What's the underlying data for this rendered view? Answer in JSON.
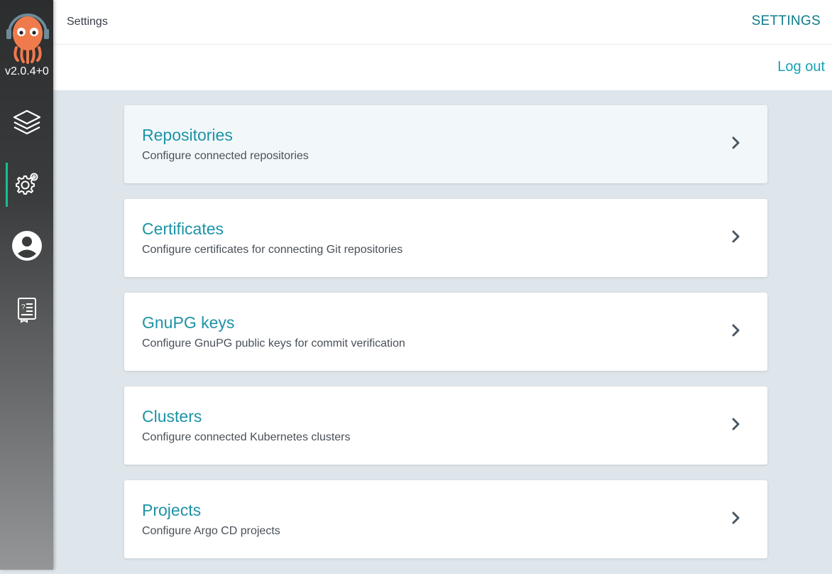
{
  "sidebar": {
    "version": "v2.0.4+0",
    "logo": "argo-octopus-logo",
    "nav": [
      {
        "id": "applications",
        "icon": "layers-icon",
        "active": false
      },
      {
        "id": "settings",
        "icon": "gears-icon",
        "active": true
      },
      {
        "id": "user-info",
        "icon": "user-icon",
        "active": false
      },
      {
        "id": "docs",
        "icon": "help-book-icon",
        "active": false
      }
    ]
  },
  "header": {
    "breadcrumb": "Settings",
    "title": "SETTINGS"
  },
  "toolbar": {
    "logout_label": "Log out"
  },
  "cards": [
    {
      "title": "Repositories",
      "description": "Configure connected repositories",
      "icon": "chevron-right-icon"
    },
    {
      "title": "Certificates",
      "description": "Configure certificates for connecting Git repositories",
      "icon": "chevron-right-icon"
    },
    {
      "title": "GnuPG keys",
      "description": "Configure GnuPG public keys for commit verification",
      "icon": "chevron-right-icon"
    },
    {
      "title": "Clusters",
      "description": "Configure connected Kubernetes clusters",
      "icon": "chevron-right-icon"
    },
    {
      "title": "Projects",
      "description": "Configure Argo CD projects",
      "icon": "chevron-right-icon"
    }
  ],
  "colors": {
    "accent": "#1d93a6",
    "title": "#0e7c8b",
    "active_indicator": "#18be94",
    "background": "#dee6eb"
  }
}
